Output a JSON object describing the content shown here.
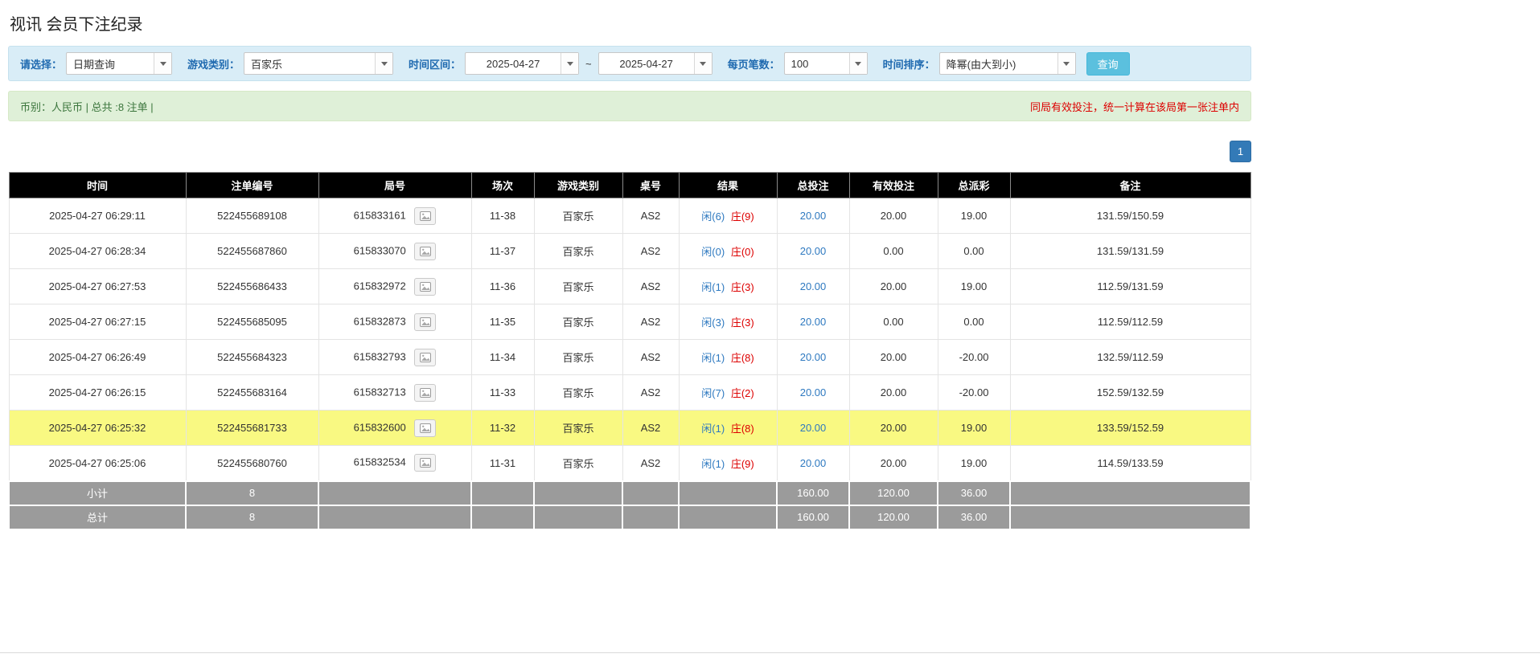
{
  "page": {
    "title": "视讯 会员下注纪录"
  },
  "filters": {
    "select_label": "请选择：",
    "select_value": "日期查询",
    "game_type_label": "游戏类别：",
    "game_type_value": "百家乐",
    "time_range_label": "时间区间：",
    "date_from": "2025-04-27",
    "range_separator": "~",
    "date_to": "2025-04-27",
    "page_size_label": "每页笔数：",
    "page_size_value": "100",
    "sort_label": "时间排序：",
    "sort_value": "降幂(由大到小)",
    "search_button_label": "查询"
  },
  "summary": {
    "left_text": "币别：人民币 | 总共 :8 注单 |",
    "right_notice": "同局有效投注，统一计算在该局第一张注单内"
  },
  "pagination": {
    "current_page": "1"
  },
  "table": {
    "headers": [
      "时间",
      "注单编号",
      "局号",
      "场次",
      "游戏类别",
      "桌号",
      "结果",
      "总投注",
      "有效投注",
      "总派彩",
      "备注"
    ],
    "rows": [
      {
        "time": "2025-04-27 06:29:11",
        "bet_id": "522455689108",
        "round_id": "615833161",
        "session": "11-38",
        "game": "百家乐",
        "table": "AS2",
        "result_player": "闲(6)",
        "result_banker": "庄(9)",
        "total_bet": "20.00",
        "valid_bet": "20.00",
        "payout": "19.00",
        "note": "131.59/150.59",
        "highlighted": false
      },
      {
        "time": "2025-04-27 06:28:34",
        "bet_id": "522455687860",
        "round_id": "615833070",
        "session": "11-37",
        "game": "百家乐",
        "table": "AS2",
        "result_player": "闲(0)",
        "result_banker": "庄(0)",
        "total_bet": "20.00",
        "valid_bet": "0.00",
        "payout": "0.00",
        "note": "131.59/131.59",
        "highlighted": false
      },
      {
        "time": "2025-04-27 06:27:53",
        "bet_id": "522455686433",
        "round_id": "615832972",
        "session": "11-36",
        "game": "百家乐",
        "table": "AS2",
        "result_player": "闲(1)",
        "result_banker": "庄(3)",
        "total_bet": "20.00",
        "valid_bet": "20.00",
        "payout": "19.00",
        "note": "112.59/131.59",
        "highlighted": false
      },
      {
        "time": "2025-04-27 06:27:15",
        "bet_id": "522455685095",
        "round_id": "615832873",
        "session": "11-35",
        "game": "百家乐",
        "table": "AS2",
        "result_player": "闲(3)",
        "result_banker": "庄(3)",
        "total_bet": "20.00",
        "valid_bet": "0.00",
        "payout": "0.00",
        "note": "112.59/112.59",
        "highlighted": false
      },
      {
        "time": "2025-04-27 06:26:49",
        "bet_id": "522455684323",
        "round_id": "615832793",
        "session": "11-34",
        "game": "百家乐",
        "table": "AS2",
        "result_player": "闲(1)",
        "result_banker": "庄(8)",
        "total_bet": "20.00",
        "valid_bet": "20.00",
        "payout": "-20.00",
        "note": "132.59/112.59",
        "highlighted": false
      },
      {
        "time": "2025-04-27 06:26:15",
        "bet_id": "522455683164",
        "round_id": "615832713",
        "session": "11-33",
        "game": "百家乐",
        "table": "AS2",
        "result_player": "闲(7)",
        "result_banker": "庄(2)",
        "total_bet": "20.00",
        "valid_bet": "20.00",
        "payout": "-20.00",
        "note": "152.59/132.59",
        "highlighted": false
      },
      {
        "time": "2025-04-27 06:25:32",
        "bet_id": "522455681733",
        "round_id": "615832600",
        "session": "11-32",
        "game": "百家乐",
        "table": "AS2",
        "result_player": "闲(1)",
        "result_banker": "庄(8)",
        "total_bet": "20.00",
        "valid_bet": "20.00",
        "payout": "19.00",
        "note": "133.59/152.59",
        "highlighted": true
      },
      {
        "time": "2025-04-27 06:25:06",
        "bet_id": "522455680760",
        "round_id": "615832534",
        "session": "11-31",
        "game": "百家乐",
        "table": "AS2",
        "result_player": "闲(1)",
        "result_banker": "庄(9)",
        "total_bet": "20.00",
        "valid_bet": "20.00",
        "payout": "19.00",
        "note": "114.59/133.59",
        "highlighted": false
      }
    ],
    "subtotal": {
      "label": "小计",
      "count": "8",
      "total_bet": "160.00",
      "valid_bet": "120.00",
      "payout": "36.00"
    },
    "total": {
      "label": "总计",
      "count": "8",
      "total_bet": "160.00",
      "valid_bet": "120.00",
      "payout": "36.00"
    }
  },
  "icons": {
    "combo_arrow": "chevron-down-icon",
    "round_image_button": "image-icon"
  },
  "colors": {
    "label-blue": "#1f6ab0",
    "link-blue": "#2e79c0",
    "red": "#dd0000",
    "filter-bg": "#d9edf7",
    "filter-border": "#c5e1ee",
    "summary-bg": "#dff0d8",
    "summary-border": "#d6e9c6",
    "summary-text": "#3c763d",
    "table-header-bg": "#000000",
    "footer-row-bg": "#9b9b9b",
    "highlight-row": "#f9f982",
    "button-bg": "#5bc0de",
    "pagination-bg": "#337ab7"
  }
}
